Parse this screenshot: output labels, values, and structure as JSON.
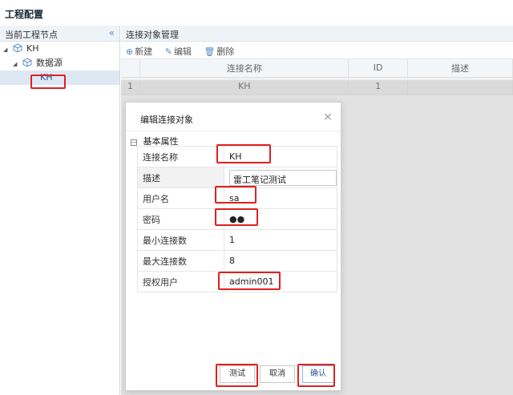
{
  "page": {
    "title": "工程配置"
  },
  "left": {
    "header": "当前工程节点",
    "collapse_icon": "«",
    "tree": [
      {
        "label": "KH"
      },
      {
        "label": "数据源"
      },
      {
        "label": "KH"
      }
    ]
  },
  "right": {
    "header": "连接对象管理",
    "toolbar": {
      "new": "新建",
      "edit": "编辑",
      "delete": "删除"
    },
    "columns": [
      "连接名称",
      "ID",
      "描述"
    ],
    "rows": [
      {
        "index": "1",
        "name": "KH",
        "id": "1",
        "desc": ""
      }
    ]
  },
  "dialog": {
    "title": "编辑连接对象",
    "close": "×",
    "section": "基本属性",
    "props": [
      {
        "key": "连接名称",
        "value": "KH"
      },
      {
        "key": "描述",
        "value": "雷工笔记测试"
      },
      {
        "key": "用户名",
        "value": "sa"
      },
      {
        "key": "密码",
        "value": "●●"
      },
      {
        "key": "最小连接数",
        "value": "1"
      },
      {
        "key": "最大连接数",
        "value": "8"
      },
      {
        "key": "授权用户",
        "value": "admin001"
      }
    ],
    "buttons": {
      "test": "测试",
      "cancel": "取消",
      "ok": "确认"
    }
  },
  "colors": {
    "accent": "#5b8ec4",
    "highlight": "#e02020"
  }
}
